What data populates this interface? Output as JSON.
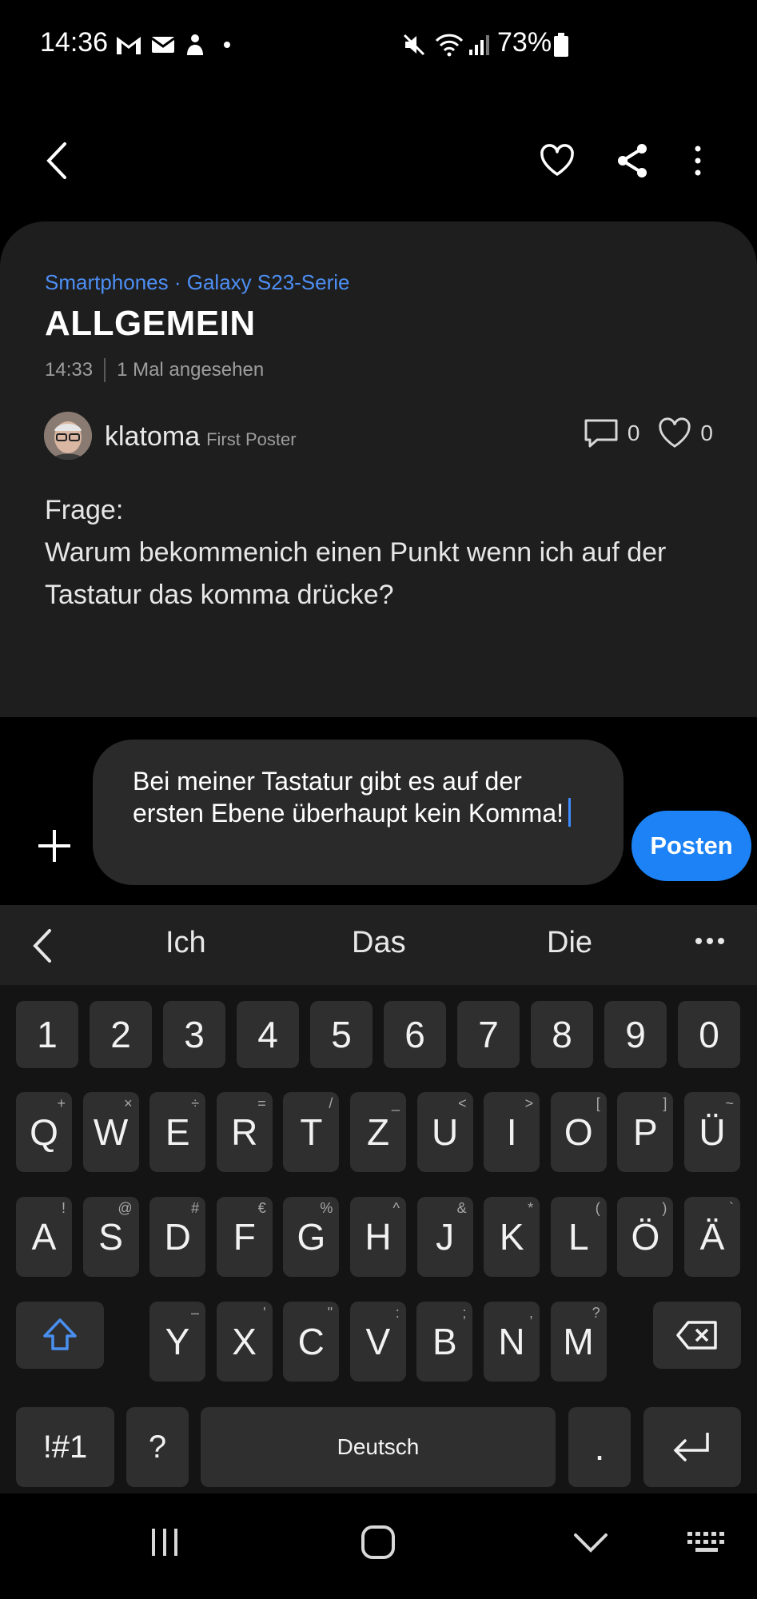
{
  "status_bar": {
    "time": "14:36",
    "battery": "73%",
    "icons": [
      "gmail-icon",
      "mail-icon",
      "bixby-icon",
      "dot-icon",
      "mute-icon",
      "wifi-icon",
      "signal-icon",
      "battery-icon"
    ]
  },
  "post": {
    "breadcrumb": "Smartphones · Galaxy S23-Serie",
    "title": "ALLGEMEIN",
    "time": "14:33",
    "views": "1 Mal angesehen",
    "author": "klatoma",
    "author_rank": "First Poster",
    "comment_count": "0",
    "like_count": "0",
    "body_line1": "Frage:",
    "body_line2": "Warum bekommenich einen Punkt wenn ich auf der Tastatur das komma drücke?"
  },
  "reply": {
    "text": "Bei meiner Tastatur gibt es auf der ersten Ebene überhaupt kein Komma!",
    "post_label": "Posten"
  },
  "keyboard": {
    "suggestions": [
      "Ich",
      "Das",
      "Die"
    ],
    "row_numbers": [
      "1",
      "2",
      "3",
      "4",
      "5",
      "6",
      "7",
      "8",
      "9",
      "0"
    ],
    "row1": [
      {
        "k": "Q",
        "a": "+"
      },
      {
        "k": "W",
        "a": "×"
      },
      {
        "k": "E",
        "a": "÷"
      },
      {
        "k": "R",
        "a": "="
      },
      {
        "k": "T",
        "a": "/"
      },
      {
        "k": "Z",
        "a": "_"
      },
      {
        "k": "U",
        "a": "<"
      },
      {
        "k": "I",
        "a": ">"
      },
      {
        "k": "O",
        "a": "["
      },
      {
        "k": "P",
        "a": "]"
      },
      {
        "k": "Ü",
        "a": "~"
      }
    ],
    "row2": [
      {
        "k": "A",
        "a": "!"
      },
      {
        "k": "S",
        "a": "@"
      },
      {
        "k": "D",
        "a": "#"
      },
      {
        "k": "F",
        "a": "€"
      },
      {
        "k": "G",
        "a": "%"
      },
      {
        "k": "H",
        "a": "^"
      },
      {
        "k": "J",
        "a": "&"
      },
      {
        "k": "K",
        "a": "*"
      },
      {
        "k": "L",
        "a": "("
      },
      {
        "k": "Ö",
        "a": ")"
      },
      {
        "k": "Ä",
        "a": "`"
      }
    ],
    "row3": [
      {
        "k": "Y",
        "a": "–"
      },
      {
        "k": "X",
        "a": "'"
      },
      {
        "k": "C",
        "a": "\""
      },
      {
        "k": "V",
        "a": ":"
      },
      {
        "k": "B",
        "a": ";"
      },
      {
        "k": "N",
        "a": ","
      },
      {
        "k": "M",
        "a": "?"
      }
    ],
    "symbols_label": "!#1",
    "question_label": "?",
    "space_label": "Deutsch",
    "period_label": "."
  },
  "colors": {
    "accent": "#1c82f5",
    "link": "#4d8ff5",
    "card_bg": "#1e1e1e",
    "key_bg": "#2f2f2f"
  }
}
